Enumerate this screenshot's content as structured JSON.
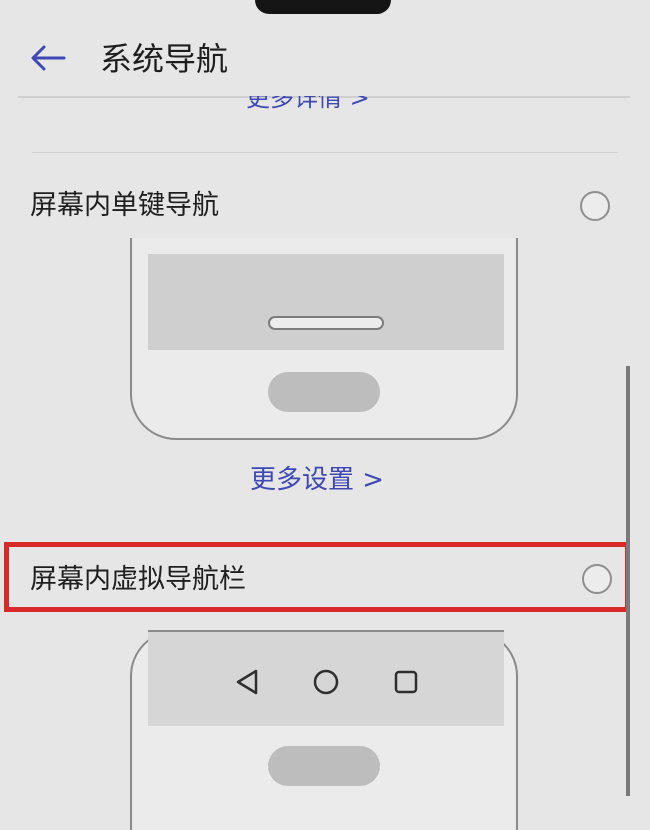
{
  "header": {
    "back_icon": "arrow-left-icon",
    "title": "系统导航"
  },
  "section_top": {
    "more_details_label": "更多详情 >"
  },
  "options": [
    {
      "label": "屏幕内单键导航",
      "selected": false,
      "more_settings_label": "更多设置 >"
    },
    {
      "label": "屏幕内虚拟导航栏",
      "selected": false,
      "highlighted": true,
      "nav_icons": [
        "back-triangle-icon",
        "home-circle-icon",
        "recents-square-icon"
      ]
    }
  ],
  "colors": {
    "accent": "#3d48b5",
    "highlight": "#d92a2a",
    "background": "#e6e6e6"
  }
}
